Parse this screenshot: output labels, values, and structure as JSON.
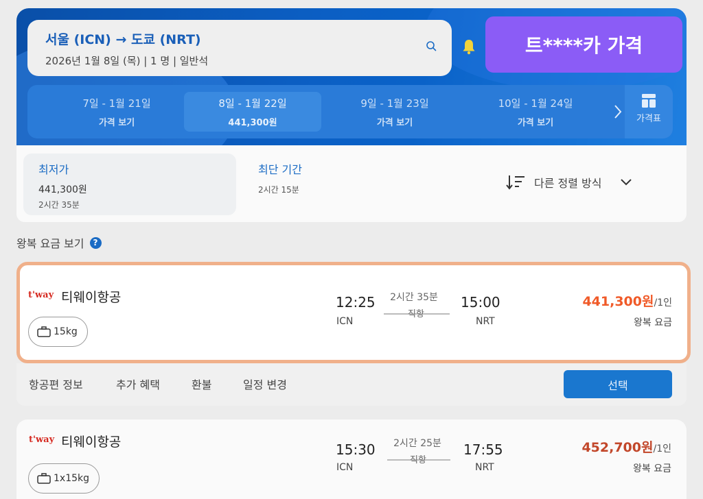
{
  "search": {
    "route": "서울 (ICN) → 도쿄 (NRT)",
    "trip_info": "2026년 1월 8일 (목) | 1 명 | 일반석"
  },
  "overlay": {
    "price_tag": "트****카 가격"
  },
  "dates": [
    {
      "range": "7일 - 1월 21일",
      "price": "가격 보기",
      "selected": false
    },
    {
      "range": "8일 - 1월 22일",
      "price": "441,300원",
      "selected": true
    },
    {
      "range": "9일 - 1월 23일",
      "price": "가격 보기",
      "selected": false
    },
    {
      "range": "10일 - 1월 24일",
      "price": "가격 보기",
      "selected": false
    }
  ],
  "grid_label": "가격표",
  "sort": {
    "cheapest": {
      "label": "최저가",
      "price": "441,300원",
      "duration": "2시간 35분"
    },
    "fastest": {
      "label": "최단 기간",
      "duration": "2시간 15분"
    },
    "other": "다른 정렬 방식"
  },
  "roundtrip_label": "왕복 요금 보기",
  "help_glyph": "?",
  "flights": [
    {
      "airline_logo": "t'way",
      "airline": "티웨이항공",
      "baggage": "15kg",
      "dep_time": "12:25",
      "dep_airport": "ICN",
      "duration": "2시간 35분",
      "stops": "직항",
      "arr_time": "15:00",
      "arr_airport": "NRT",
      "price": "441,300원",
      "unit": "/1인",
      "fare_type": "왕복 요금"
    },
    {
      "airline_logo": "t'way",
      "airline": "티웨이항공",
      "baggage": "1x15kg",
      "dep_time": "15:30",
      "dep_airport": "ICN",
      "duration": "2시간 25분",
      "stops": "직항",
      "arr_time": "17:55",
      "arr_airport": "NRT",
      "price": "452,700원",
      "unit": "/1인",
      "fare_type": "왕복 요금"
    }
  ],
  "actions": {
    "flight_info": "항공편 정보",
    "extras": "추가 혜택",
    "refund": "환불",
    "change": "일정 변경",
    "select": "선택"
  },
  "colors": {
    "brand_blue": "#0b5fc4",
    "price_orange": "#f05a28",
    "highlight_border": "#f0b08a",
    "overlay_purple": "#8b5cf6"
  }
}
